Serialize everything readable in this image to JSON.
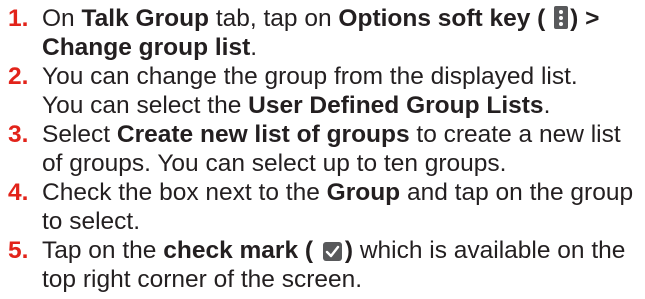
{
  "steps": [
    {
      "number": "1.",
      "t1": "On ",
      "b1": "Talk Group",
      "t2": " tab, tap on ",
      "b2": "Options soft key (",
      "b3": ") >",
      "b4": "Change group list",
      "t3": "."
    },
    {
      "number": "2.",
      "t1": "You can change the group from the displayed list.",
      "t2": "You can select the ",
      "b1": "User Defined Group Lists",
      "t3": "."
    },
    {
      "number": "3.",
      "t1": "Select ",
      "b1": "Create new list of groups",
      "t2": " to create a new list of groups. You can select up to ten groups."
    },
    {
      "number": "4.",
      "t1": "Check the box next to the ",
      "b1": "Group",
      "t2": " and tap on the group to select."
    },
    {
      "number": "5.",
      "t1": "Tap on the ",
      "b1": "check mark (",
      "b2": ")",
      "t2": " which is available on the top right corner of the screen."
    }
  ],
  "colors": {
    "number": "#e2231a",
    "text": "#231f20",
    "icon": "#58595b"
  },
  "icons": [
    "options-kebab-icon",
    "check-mark-icon"
  ]
}
